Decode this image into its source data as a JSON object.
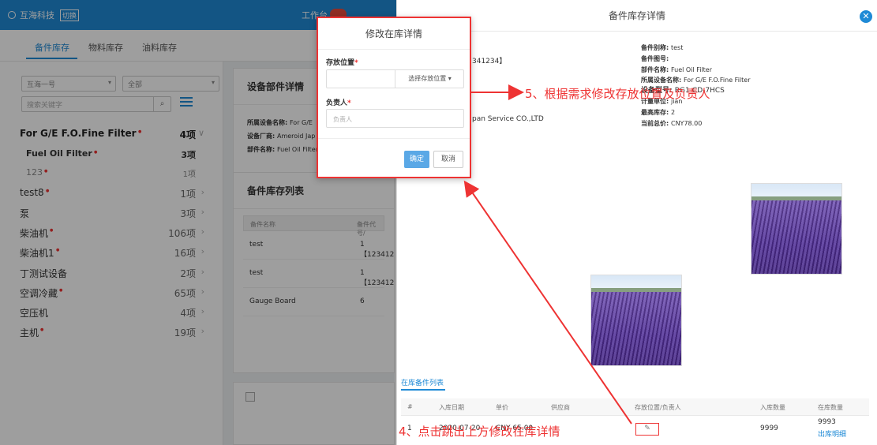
{
  "topbar": {
    "company": "互海科技",
    "switch_label": "切换",
    "work_label": "工作台"
  },
  "tabs": [
    {
      "label": "备件库存",
      "active": true
    },
    {
      "label": "物料库存",
      "active": false
    },
    {
      "label": "油料库存",
      "active": false
    }
  ],
  "filters": {
    "ship": "互海一号",
    "category": "全部",
    "search_placeholder": "搜索关键字"
  },
  "tree": [
    {
      "name": "For G/E F.O.Fine Filter",
      "star": true,
      "count": "4项",
      "arrow": "∨",
      "level": 1
    },
    {
      "name": "Fuel Oil Filter",
      "star": true,
      "count": "3项",
      "arrow": "",
      "level": 2
    },
    {
      "name": "123",
      "star": true,
      "count": "1项",
      "arrow": "",
      "level": 3
    },
    {
      "name": "test8",
      "star": true,
      "count": "1项",
      "arrow": "›",
      "level": 0
    },
    {
      "name": "泵",
      "star": false,
      "count": "3项",
      "arrow": "›",
      "level": 0
    },
    {
      "name": "柴油机",
      "star": true,
      "count": "106项",
      "arrow": "›",
      "level": 0
    },
    {
      "name": "柴油机1",
      "star": true,
      "count": "16项",
      "arrow": "›",
      "level": 0
    },
    {
      "name": "丁测试设备",
      "star": false,
      "count": "2项",
      "arrow": "›",
      "level": 0
    },
    {
      "name": "空调冷藏",
      "star": true,
      "count": "65项",
      "arrow": "›",
      "level": 0
    },
    {
      "name": "空压机",
      "star": false,
      "count": "4项",
      "arrow": "›",
      "level": 0
    },
    {
      "name": "主机",
      "star": true,
      "count": "19项",
      "arrow": "›",
      "level": 0
    }
  ],
  "equipment_card": {
    "title": "设备部件详情",
    "lines": [
      {
        "k": "所属设备名称: ",
        "v": "For G/E"
      },
      {
        "k": "设备厂商: ",
        "v": "Ameroid Jap"
      },
      {
        "k": "部件名称: ",
        "v": "Fuel Oil Filter"
      }
    ]
  },
  "stock_list": {
    "title": "备件库存列表",
    "headers": [
      "备件名称",
      "备件代号/"
    ],
    "rows": [
      {
        "name": "test",
        "code": "1【123412"
      },
      {
        "name": "test",
        "code": "1【123412"
      },
      {
        "name": "Gauge Board",
        "code": "6"
      }
    ]
  },
  "drawer": {
    "title": "备件库存详情",
    "left_lines": [
      "341234】",
      "pan Service CO.,LTD"
    ],
    "right_lines": [
      {
        "k": "备件别称: ",
        "v": "test"
      },
      {
        "k": "备件图号: ",
        "v": ""
      },
      {
        "k": "部件名称: ",
        "v": "Fuel Oil Filter"
      },
      {
        "k": "所属设备名称: ",
        "v": "For G/E F.O.Fine Filter"
      },
      {
        "k": "设备型号: ",
        "v": "RG1-CD-7HCS"
      },
      {
        "k": "计量单位: ",
        "v": "jian"
      },
      {
        "k": "最高库存: ",
        "v": "2"
      },
      {
        "k": "当前总价: ",
        "v": "CNY78.00"
      }
    ],
    "sub_tab": "在库备件列表",
    "table_headers": [
      "#",
      "入库日期",
      "单价",
      "供应商",
      "存放位置/负责人",
      "入库数量",
      "在库数量"
    ],
    "row": {
      "idx": "1",
      "date": "2020-07-20",
      "price": "CNY 65.00",
      "in_qty": "9999",
      "stock_qty": "9993",
      "detail_link": "出库明细"
    }
  },
  "modal": {
    "title": "修改在库详情",
    "location_label": "存放位置",
    "location_select": "选择存放位置",
    "owner_label": "负责人",
    "owner_placeholder": "负责人",
    "ok": "确定",
    "cancel": "取消"
  },
  "annotations": {
    "step5": "5、根据需求修改存放位置及负责人",
    "step4": "4、点击跳出上方修改在库详情"
  },
  "colors": {
    "primary": "#1f8ad6",
    "annotation": "#e33333",
    "required": "#e33333"
  }
}
